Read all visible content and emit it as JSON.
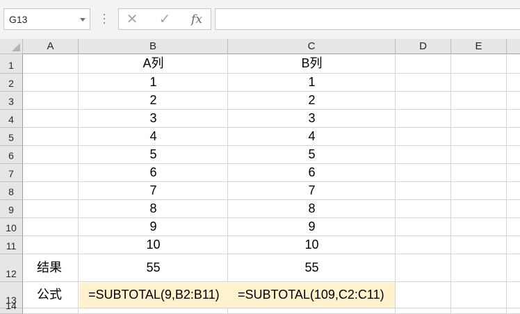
{
  "name_box": {
    "value": "G13"
  },
  "formula_bar": {
    "cancel_glyph": "✕",
    "enter_glyph": "✓",
    "fx_label": "fx",
    "content": ""
  },
  "columns": [
    "A",
    "B",
    "C",
    "D",
    "E"
  ],
  "rows": [
    "1",
    "2",
    "3",
    "4",
    "5",
    "6",
    "7",
    "8",
    "9",
    "10",
    "11",
    "12",
    "13",
    "14"
  ],
  "cells": {
    "B1": "A列",
    "C1": "B列",
    "B2": "1",
    "C2": "1",
    "B3": "2",
    "C3": "2",
    "B4": "3",
    "C4": "3",
    "B5": "4",
    "C5": "4",
    "B6": "5",
    "C6": "5",
    "B7": "6",
    "C7": "6",
    "B8": "7",
    "C8": "7",
    "B9": "8",
    "C9": "8",
    "B10": "9",
    "C10": "9",
    "B11": "10",
    "C11": "10",
    "A12": "结果",
    "B12": "55",
    "C12": "55",
    "A13": "公式",
    "B13": "=SUBTOTAL(9,B2:B11)",
    "C13": "=SUBTOTAL(109,C2:C11)"
  },
  "colors": {
    "highlight_fill": "#fff2cc",
    "header_fill": "#e6e6e6",
    "gridline": "#d4d4d4"
  }
}
